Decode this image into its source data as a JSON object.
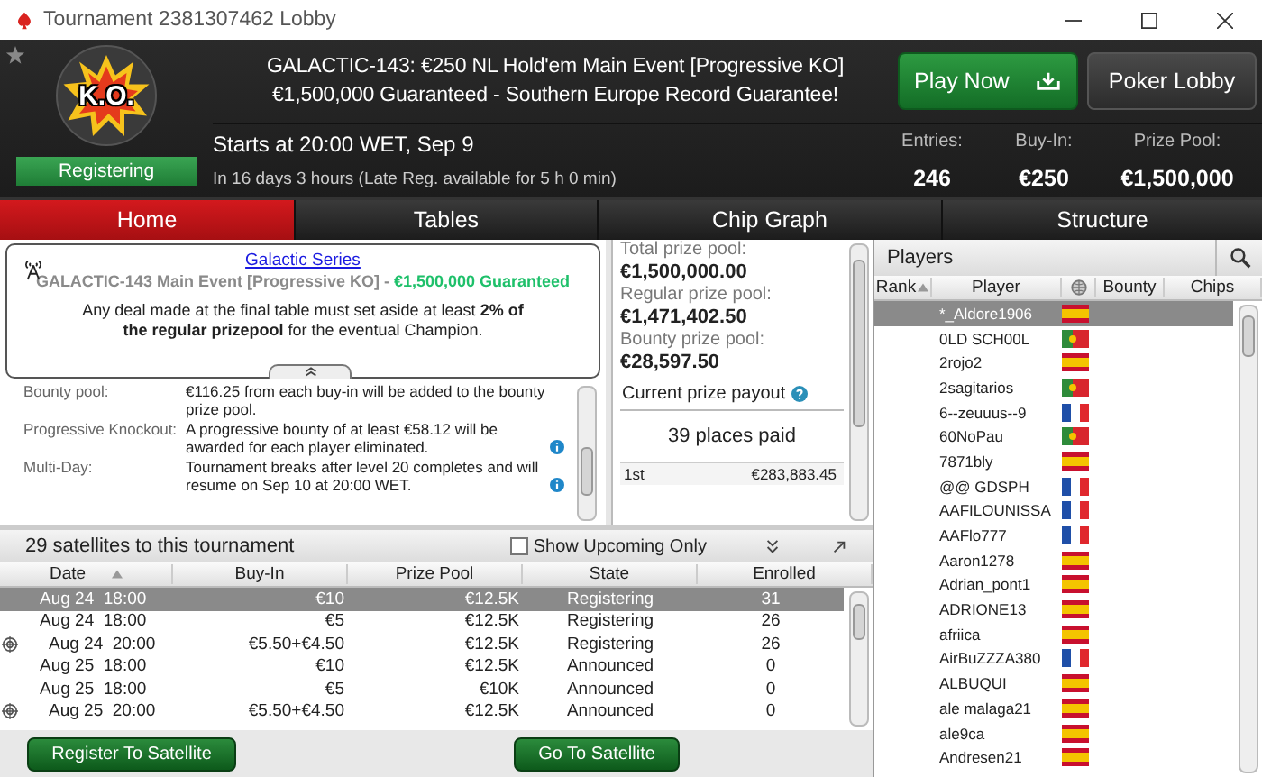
{
  "window": {
    "title": "Tournament 2381307462 Lobby"
  },
  "header": {
    "badge": "K.O.",
    "status": "Registering",
    "title_line_1": "GALACTIC-143: €250 NL Hold'em Main Event [Progressive KO]",
    "title_line_2": "€1,500,000 Guaranteed - Southern Europe Record Guarantee!",
    "starts": "Starts at 20:00 WET, Sep 9",
    "countdown": "In 16 days 3 hours (Late Reg. available for 5 h 0 min)",
    "stats": [
      {
        "label": "Entries:",
        "value": "246"
      },
      {
        "label": "Buy-In:",
        "value": "€250"
      },
      {
        "label": "Prize Pool:",
        "value": "€1,500,000"
      }
    ],
    "buttons": [
      {
        "label": "Play Now",
        "kind": "primary"
      },
      {
        "label": "Poker Lobby",
        "kind": "secondary"
      }
    ]
  },
  "tabs": [
    {
      "label": "Home",
      "selected": true
    },
    {
      "label": "Tables",
      "selected": false
    },
    {
      "label": "Chip Graph",
      "selected": false
    },
    {
      "label": "Structure",
      "selected": false
    }
  ],
  "notice": {
    "link": "Galactic Series",
    "event": "GALACTIC-143 Main Event [Progressive KO]",
    "separator": " - ",
    "guarantee": "€1,500,000 Guaranteed",
    "message": "Any deal made at the final table must set aside at least **2% of the regular prizepool** for the eventual Champion."
  },
  "details": [
    {
      "label": "Bounty pool:",
      "text": "€116.25 from each buy-in will be added to the bounty prize pool.",
      "info": false
    },
    {
      "label": "Progressive Knockout:",
      "text": "A progressive bounty of at least €58.12 will be awarded for each player eliminated.",
      "info": true
    },
    {
      "label": "Multi-Day:",
      "text": "Tournament breaks after level 20 completes and will resume on Sep 10 at 20:00 WET.",
      "info": true
    }
  ],
  "prizes": {
    "pools": [
      {
        "label": "Total prize pool:",
        "value": "€1,500,000.00"
      },
      {
        "label": "Regular prize pool:",
        "value": "€1,471,402.50"
      },
      {
        "label": "Bounty prize pool:",
        "value": "€28,597.50"
      }
    ],
    "payout_title": "Current prize payout",
    "places": "39 places paid",
    "rows": [
      {
        "place": "1st",
        "amount": "€283,883.45"
      }
    ]
  },
  "satellites": {
    "title": "29 satellites to this tournament",
    "filter": {
      "label": "Show Upcoming Only",
      "checked": false
    },
    "columns": [
      "Date",
      "Buy-In",
      "Prize Pool",
      "State",
      "Enrolled"
    ],
    "rows": [
      {
        "date": "Aug 24  18:00",
        "buy_in": "€10",
        "prize_pool": "€12.5K",
        "state": "Registering",
        "enrolled": "31",
        "selected": true,
        "target": false
      },
      {
        "date": "Aug 24  18:00",
        "buy_in": "€5",
        "prize_pool": "€12.5K",
        "state": "Registering",
        "enrolled": "26",
        "selected": false,
        "target": false
      },
      {
        "date": "Aug 24  20:00",
        "buy_in": "€5.50+€4.50",
        "prize_pool": "€12.5K",
        "state": "Registering",
        "enrolled": "26",
        "selected": false,
        "target": true
      },
      {
        "date": "Aug 25  18:00",
        "buy_in": "€10",
        "prize_pool": "€12.5K",
        "state": "Announced",
        "enrolled": "0",
        "selected": false,
        "target": false
      },
      {
        "date": "Aug 25  18:00",
        "buy_in": "€5",
        "prize_pool": "€10K",
        "state": "Announced",
        "enrolled": "0",
        "selected": false,
        "target": false
      },
      {
        "date": "Aug 25  20:00",
        "buy_in": "€5.50+€4.50",
        "prize_pool": "€12.5K",
        "state": "Announced",
        "enrolled": "0",
        "selected": false,
        "target": true
      }
    ],
    "buttons": [
      "Register To Satellite",
      "Go To Satellite"
    ]
  },
  "players": {
    "title": "Players",
    "columns": [
      "Rank",
      "Player",
      "Bounty",
      "Chips"
    ],
    "rows": [
      {
        "name": "*_Aldore1906",
        "kind": "es",
        "selected": true
      },
      {
        "name": "0LD SCH00L",
        "kind": "pt",
        "selected": false
      },
      {
        "name": "2rojo2",
        "kind": "es",
        "selected": false
      },
      {
        "name": "2sagitarios",
        "kind": "pt",
        "selected": false
      },
      {
        "name": "6--zeuuus--9",
        "kind": "fr",
        "selected": false
      },
      {
        "name": "60NoPau",
        "kind": "pt",
        "selected": false
      },
      {
        "name": "7871bly",
        "kind": "es",
        "selected": false
      },
      {
        "name": "@@ GDSPH",
        "kind": "fr",
        "selected": false
      },
      {
        "name": "AAFILOUNISSA",
        "kind": "fr",
        "selected": false
      },
      {
        "name": "AAFlo777",
        "kind": "fr",
        "selected": false
      },
      {
        "name": "Aaron1278",
        "kind": "es",
        "selected": false
      },
      {
        "name": "Adrian_pont1",
        "kind": "es",
        "selected": false
      },
      {
        "name": "ADRIONE13",
        "kind": "es",
        "selected": false
      },
      {
        "name": "afriica",
        "kind": "es",
        "selected": false
      },
      {
        "name": "AirBuZZZA380",
        "kind": "fr",
        "selected": false
      },
      {
        "name": "ALBUQUI",
        "kind": "es",
        "selected": false
      },
      {
        "name": "ale malaga21",
        "kind": "es",
        "selected": false
      },
      {
        "name": "ale9ca",
        "kind": "es",
        "selected": false
      },
      {
        "name": "Andresen21",
        "kind": "es",
        "selected": false
      }
    ]
  }
}
